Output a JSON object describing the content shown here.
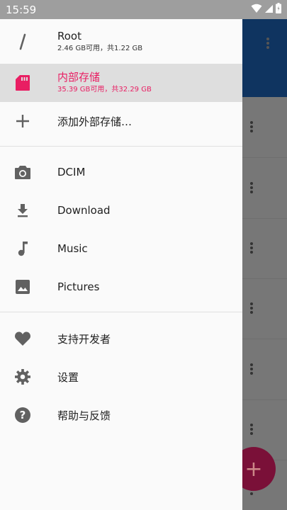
{
  "status_bar": {
    "time": "15:59"
  },
  "drawer": {
    "storages": [
      {
        "title": "Root",
        "subtitle": "2.46 GB可用，共1.22 GB",
        "icon": "slash-icon",
        "active": false
      },
      {
        "title": "内部存储",
        "subtitle": "35.39 GB可用，共32.29 GB",
        "icon": "sd-card-icon",
        "active": true
      }
    ],
    "add_storage_label": "添加外部存储…",
    "bookmarks": [
      {
        "label": "DCIM",
        "icon": "camera-icon"
      },
      {
        "label": "Download",
        "icon": "download-icon"
      },
      {
        "label": "Music",
        "icon": "music-note-icon"
      },
      {
        "label": "Pictures",
        "icon": "image-icon"
      }
    ],
    "footer_items": [
      {
        "label": "支持开发者",
        "icon": "heart-icon"
      },
      {
        "label": "设置",
        "icon": "gear-icon"
      },
      {
        "label": "帮助与反馈",
        "icon": "help-icon"
      }
    ]
  },
  "fab": {
    "label": "+"
  },
  "colors": {
    "accent": "#e91e63",
    "appbar": "#0f3460",
    "fab": "#7a1038"
  }
}
